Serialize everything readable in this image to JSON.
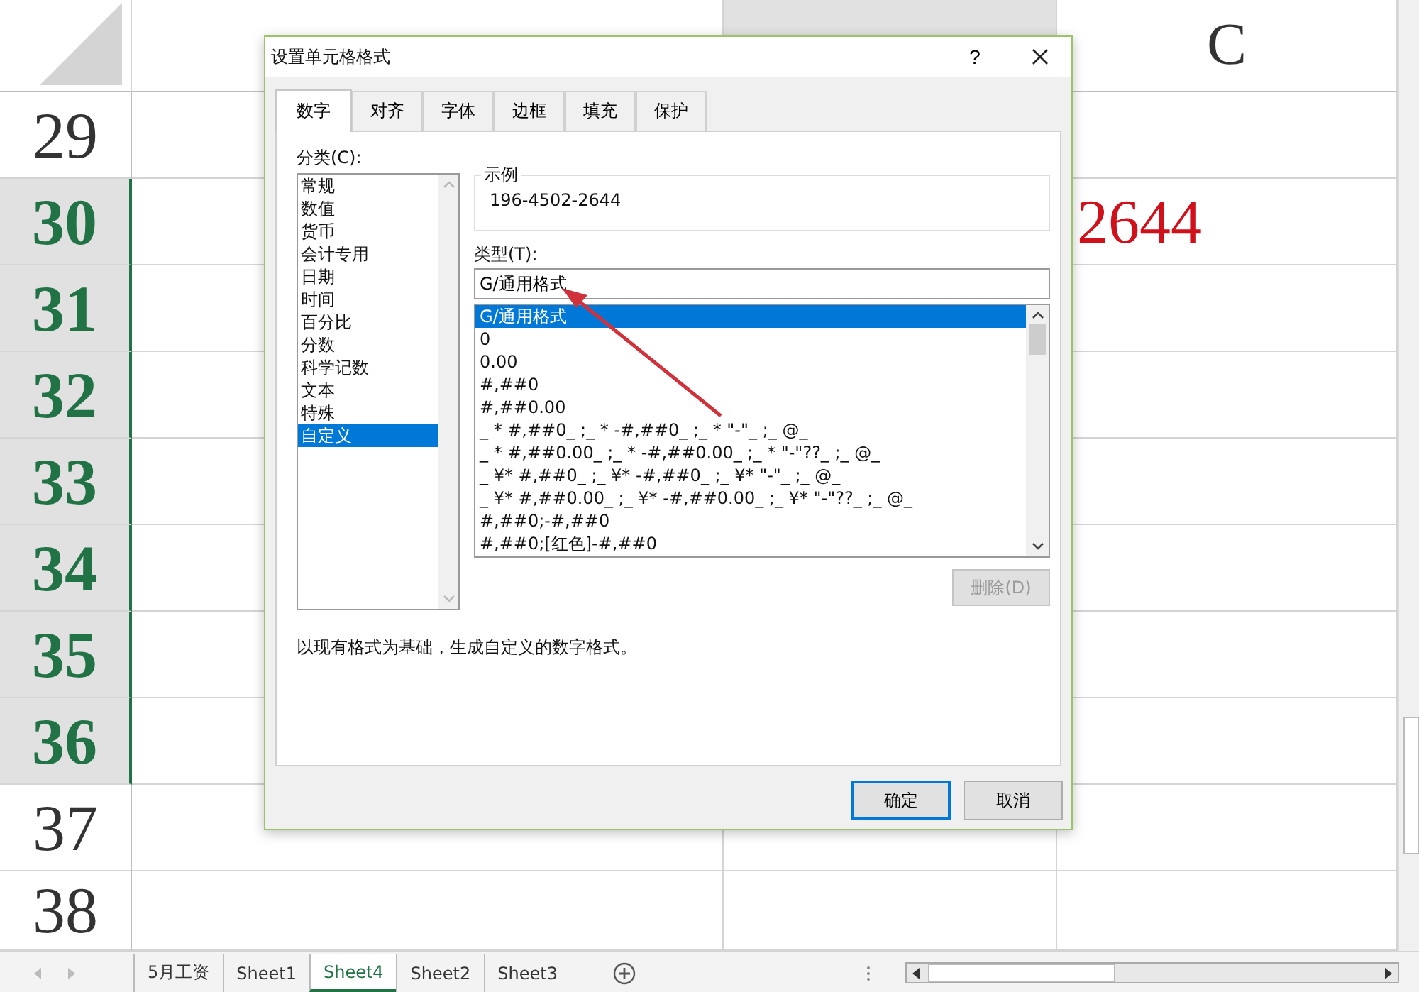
{
  "columns": [
    {
      "selected": false
    },
    {
      "selected": true
    },
    {
      "label": "C",
      "selected": false
    }
  ],
  "rows": [
    {
      "number": "29",
      "selected": false
    },
    {
      "number": "30",
      "selected": true,
      "cell_c": "2644"
    },
    {
      "number": "31",
      "selected": true
    },
    {
      "number": "32",
      "selected": true
    },
    {
      "number": "33",
      "selected": true
    },
    {
      "number": "34",
      "selected": true
    },
    {
      "number": "35",
      "selected": true
    },
    {
      "number": "36",
      "selected": true
    },
    {
      "number": "37",
      "selected": false
    },
    {
      "number": "38",
      "selected": false
    }
  ],
  "dialog": {
    "title": "设置单元格格式",
    "help": "?",
    "tabs": [
      {
        "label": "数字",
        "selected": true
      },
      {
        "label": "对齐",
        "selected": false
      },
      {
        "label": "字体",
        "selected": false
      },
      {
        "label": "边框",
        "selected": false
      },
      {
        "label": "填充",
        "selected": false
      },
      {
        "label": "保护",
        "selected": false
      }
    ],
    "category_label": "分类(C):",
    "categories": [
      {
        "label": "常规",
        "selected": false
      },
      {
        "label": "数值",
        "selected": false
      },
      {
        "label": "货币",
        "selected": false
      },
      {
        "label": "会计专用",
        "selected": false
      },
      {
        "label": "日期",
        "selected": false
      },
      {
        "label": "时间",
        "selected": false
      },
      {
        "label": "百分比",
        "selected": false
      },
      {
        "label": "分数",
        "selected": false
      },
      {
        "label": "科学记数",
        "selected": false
      },
      {
        "label": "文本",
        "selected": false
      },
      {
        "label": "特殊",
        "selected": false
      },
      {
        "label": "自定义",
        "selected": true
      }
    ],
    "sample_label": "示例",
    "sample_value": "196-4502-2644",
    "type_label": "类型(T):",
    "type_value": "G/通用格式",
    "formats": [
      {
        "label": "G/通用格式",
        "selected": true
      },
      {
        "label": "0",
        "selected": false
      },
      {
        "label": "0.00",
        "selected": false
      },
      {
        "label": "#,##0",
        "selected": false
      },
      {
        "label": "#,##0.00",
        "selected": false
      },
      {
        "label": "_ * #,##0_ ;_ * -#,##0_ ;_ * \"-\"_ ;_ @_",
        "selected": false
      },
      {
        "label": "_ * #,##0.00_ ;_ * -#,##0.00_ ;_ * \"-\"??_ ;_ @_",
        "selected": false
      },
      {
        "label": "_ ¥* #,##0_ ;_ ¥* -#,##0_ ;_ ¥* \"-\"_ ;_ @_",
        "selected": false
      },
      {
        "label": "_ ¥* #,##0.00_ ;_ ¥* -#,##0.00_ ;_ ¥* \"-\"??_ ;_ @_",
        "selected": false
      },
      {
        "label": "#,##0;-#,##0",
        "selected": false
      },
      {
        "label": "#,##0;[红色]-#,##0",
        "selected": false
      }
    ],
    "delete_button": {
      "label": "删除(D)",
      "disabled": true
    },
    "description": "以现有格式为基础，生成自定义的数字格式。",
    "ok_label": "确定",
    "cancel_label": "取消"
  },
  "sheets": [
    {
      "label": "5月工资",
      "selected": false
    },
    {
      "label": "Sheet1",
      "selected": false
    },
    {
      "label": "Sheet4",
      "selected": true
    },
    {
      "label": "Sheet2",
      "selected": false
    },
    {
      "label": "Sheet3",
      "selected": false
    }
  ]
}
